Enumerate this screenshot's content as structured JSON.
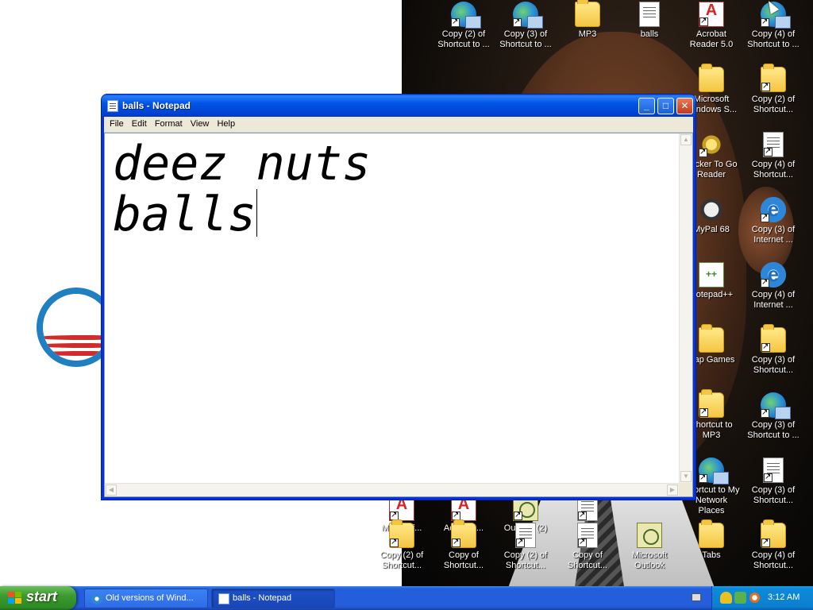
{
  "desktop": {
    "icons": [
      {
        "label": "Copy (2) of Shortcut to ...",
        "icon": "network-places-icon",
        "shortcut": true
      },
      {
        "label": "Copy (3) of Shortcut to ...",
        "icon": "network-places-icon",
        "shortcut": true
      },
      {
        "label": "MP3",
        "icon": "folder-icon",
        "shortcut": false
      },
      {
        "label": "balls",
        "icon": "text-document-icon",
        "shortcut": false
      },
      {
        "label": "Acrobat Reader 5.0",
        "icon": "acrobat-icon",
        "shortcut": true
      },
      {
        "label": "Copy (4) of Shortcut to ...",
        "icon": "network-places-icon",
        "shortcut": true
      },
      {
        "label": "Microsoft Windows S...",
        "icon": "folder-icon",
        "shortcut": false
      },
      {
        "label": "Copy (2) of Shortcut...",
        "icon": "folder-icon",
        "shortcut": true
      },
      {
        "label": "Locker To Go Reader",
        "icon": "star-icon",
        "shortcut": true
      },
      {
        "label": "Copy (4) of Shortcut...",
        "icon": "text-document-icon",
        "shortcut": true
      },
      {
        "label": "MyPal 68",
        "icon": "mascot-icon",
        "shortcut": false
      },
      {
        "label": "Copy (3) of Internet ...",
        "icon": "internet-explorer-icon",
        "shortcut": true
      },
      {
        "label": "Notepad++",
        "icon": "notepad-plus-plus-icon",
        "shortcut": false
      },
      {
        "label": "Copy (4) of Internet ...",
        "icon": "internet-explorer-icon",
        "shortcut": true
      },
      {
        "label": "Cap Games",
        "icon": "folder-icon",
        "shortcut": false
      },
      {
        "label": "Copy (3) of Shortcut...",
        "icon": "folder-icon",
        "shortcut": true
      },
      {
        "label": "Shortcut to MP3",
        "icon": "folder-icon",
        "shortcut": true
      },
      {
        "label": "Copy (3) of Shortcut to ...",
        "icon": "network-places-icon",
        "shortcut": true
      },
      {
        "label": "Shortcut to My Network Places",
        "icon": "network-places-icon",
        "shortcut": true
      },
      {
        "label": "Copy (3) of Shortcut...",
        "icon": "text-document-icon",
        "shortcut": true
      },
      {
        "label": "Microsof...",
        "icon": "acrobat-icon",
        "shortcut": true
      },
      {
        "label": "Acrobat ...",
        "icon": "acrobat-icon",
        "shortcut": true
      },
      {
        "label": "Outlook (2)",
        "icon": "outlook-icon",
        "shortcut": true
      },
      {
        "label": "Balls",
        "icon": "text-document-icon",
        "shortcut": true
      },
      {
        "label": "Copy (2) of Shortcut...",
        "icon": "folder-icon",
        "shortcut": true
      },
      {
        "label": "Copy of Shortcut...",
        "icon": "folder-icon",
        "shortcut": true
      },
      {
        "label": "Copy (2) of Shortcut...",
        "icon": "text-document-icon",
        "shortcut": true
      },
      {
        "label": "Copy of Shortcut...",
        "icon": "text-document-icon",
        "shortcut": true
      },
      {
        "label": "Microsoft Outlook",
        "icon": "outlook-icon",
        "shortcut": false
      },
      {
        "label": "Tabs",
        "icon": "folder-icon",
        "shortcut": false
      },
      {
        "label": "Copy (4) of Shortcut...",
        "icon": "folder-icon",
        "shortcut": true
      }
    ]
  },
  "notepad": {
    "title": "balls - Notepad",
    "menu": [
      "File",
      "Edit",
      "Format",
      "View",
      "Help"
    ],
    "content_lines": [
      "deez nuts",
      "balls"
    ]
  },
  "taskbar": {
    "start_label": "start",
    "tasks": [
      {
        "label": "Old versions of Wind...",
        "icon": "internet-explorer-icon",
        "active": false
      },
      {
        "label": "balls - Notepad",
        "icon": "notepad-icon",
        "active": true
      }
    ],
    "clock": "3:12 AM"
  },
  "colors": {
    "titlebar": "#0055e5",
    "taskbar": "#245edb",
    "start_button": "#3c9a2e",
    "tray": "#0c80d0"
  }
}
